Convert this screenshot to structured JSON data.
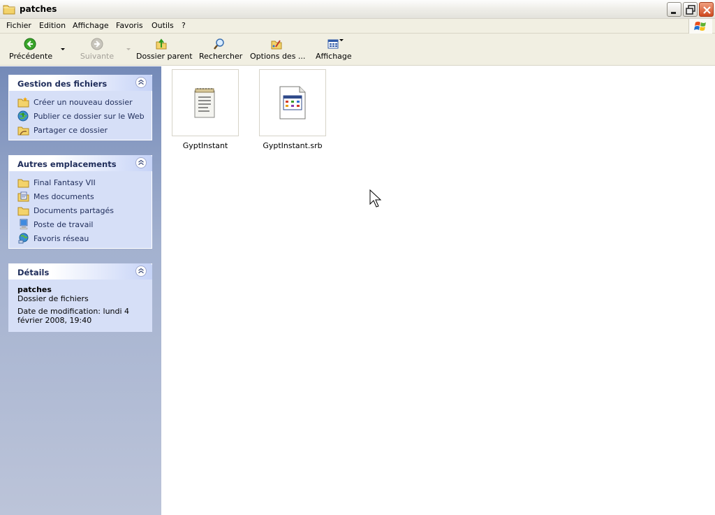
{
  "window": {
    "title": "patches"
  },
  "menu": [
    "Fichier",
    "Edition",
    "Affichage",
    "Favoris",
    "Outils",
    "?"
  ],
  "toolbar": {
    "back": "Précédente",
    "forward": "Suivante",
    "up": "Dossier parent",
    "search": "Rechercher",
    "folder_options": "Options des ...",
    "view": "Affichage"
  },
  "panels": {
    "file_tasks": {
      "title": "Gestion des fichiers",
      "items": [
        "Créer un nouveau dossier",
        "Publier ce dossier sur le Web",
        "Partager ce dossier"
      ]
    },
    "other_places": {
      "title": "Autres emplacements",
      "items": [
        "Final Fantasy VII",
        "Mes documents",
        "Documents partagés",
        "Poste de travail",
        "Favoris réseau"
      ]
    },
    "details": {
      "title": "Détails",
      "name": "patches",
      "type": "Dossier de fichiers",
      "modified": "Date de modification: lundi 4 février 2008, 19:40"
    }
  },
  "files": [
    {
      "name": "GyptInstant",
      "icon": "notepad-document-icon"
    },
    {
      "name": "GyptInstant.srb",
      "icon": "settings-file-icon"
    }
  ]
}
